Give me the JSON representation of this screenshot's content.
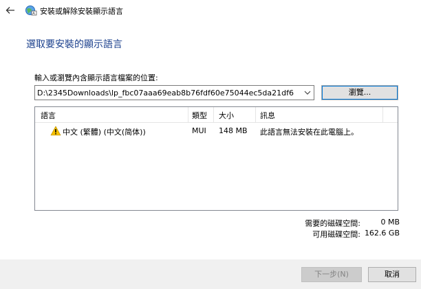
{
  "window": {
    "title": "安裝或解除安裝顯示語言"
  },
  "page": {
    "heading": "選取要安裝的顯示語言",
    "path_label": "輸入或瀏覽內含顯示語言檔案的位置:",
    "path_value": "D:\\2345Downloads\\lp_fbc07aaa69eab8b76fdf60e75044ec5da21df6",
    "browse_label": "瀏覽..."
  },
  "list": {
    "columns": [
      "語言",
      "類型",
      "大小",
      "訊息"
    ],
    "rows": [
      {
        "language": "中文 (繁體) (中文(简体))",
        "type": "MUI",
        "size": "148 MB",
        "message": "此語言無法安裝在此電腦上。",
        "status_icon": "warning-icon"
      }
    ]
  },
  "disk": {
    "required_label": "需要的磁碟空間:",
    "required_value": "0 MB",
    "available_label": "可用磁碟空間:",
    "available_value": "162.6 GB"
  },
  "footer": {
    "next_label": "下一步(N)",
    "cancel_label": "取消"
  },
  "colors": {
    "heading": "#1a3f8c",
    "focus": "#0078d7",
    "warning": "#f6c000"
  }
}
